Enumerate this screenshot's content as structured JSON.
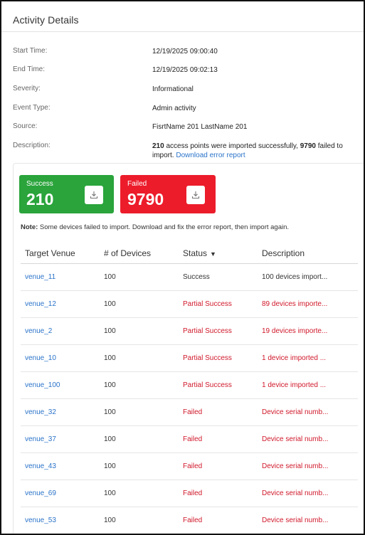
{
  "title": "Activity Details",
  "details": {
    "start_label": "Start Time:",
    "start_value": "12/19/2025 09:00:40",
    "end_label": "End Time:",
    "end_value": "12/19/2025 09:02:13",
    "severity_label": "Severity:",
    "severity_value": "Informational",
    "event_type_label": "Event Type:",
    "event_type_value": "Admin activity",
    "source_label": "Source:",
    "source_value": "FisrtName 201 LastName 201",
    "description_label": "Description:",
    "description_success_count": "210",
    "description_text_1": " access points were imported successfully, ",
    "description_failed_count": "9790",
    "description_text_2": " failed to import. ",
    "description_link": "Download error report"
  },
  "cards": {
    "success_label": "Success",
    "success_value": "210",
    "success_color": "#2aa43b",
    "failed_label": "Failed",
    "failed_value": "9790",
    "failed_color": "#ec1c2b"
  },
  "note": {
    "prefix": "Note:",
    "text": " Some devices failed to import. Download and fix the error report, then import again."
  },
  "table": {
    "headers": [
      "Target Venue",
      "# of Devices",
      "Status",
      "Description"
    ],
    "rows": [
      {
        "venue": "venue_11",
        "devices": "100",
        "status": "Success",
        "description": "100 devices import..."
      },
      {
        "venue": "venue_12",
        "devices": "100",
        "status": "Partial Success",
        "description": "89 devices importe..."
      },
      {
        "venue": "venue_2",
        "devices": "100",
        "status": "Partial Success",
        "description": "19 devices importe..."
      },
      {
        "venue": "venue_10",
        "devices": "100",
        "status": "Partial Success",
        "description": "1 device imported ..."
      },
      {
        "venue": "venue_100",
        "devices": "100",
        "status": "Partial Success",
        "description": "1 device imported ..."
      },
      {
        "venue": "venue_32",
        "devices": "100",
        "status": "Failed",
        "description": "Device serial numb..."
      },
      {
        "venue": "venue_37",
        "devices": "100",
        "status": "Failed",
        "description": "Device serial numb..."
      },
      {
        "venue": "venue_43",
        "devices": "100",
        "status": "Failed",
        "description": "Device serial numb..."
      },
      {
        "venue": "venue_69",
        "devices": "100",
        "status": "Failed",
        "description": "Device serial numb..."
      },
      {
        "venue": "venue_53",
        "devices": "100",
        "status": "Failed",
        "description": "Device serial numb..."
      }
    ]
  },
  "colors": {
    "link": "#2a73c9",
    "error_text": "#d0182a"
  }
}
